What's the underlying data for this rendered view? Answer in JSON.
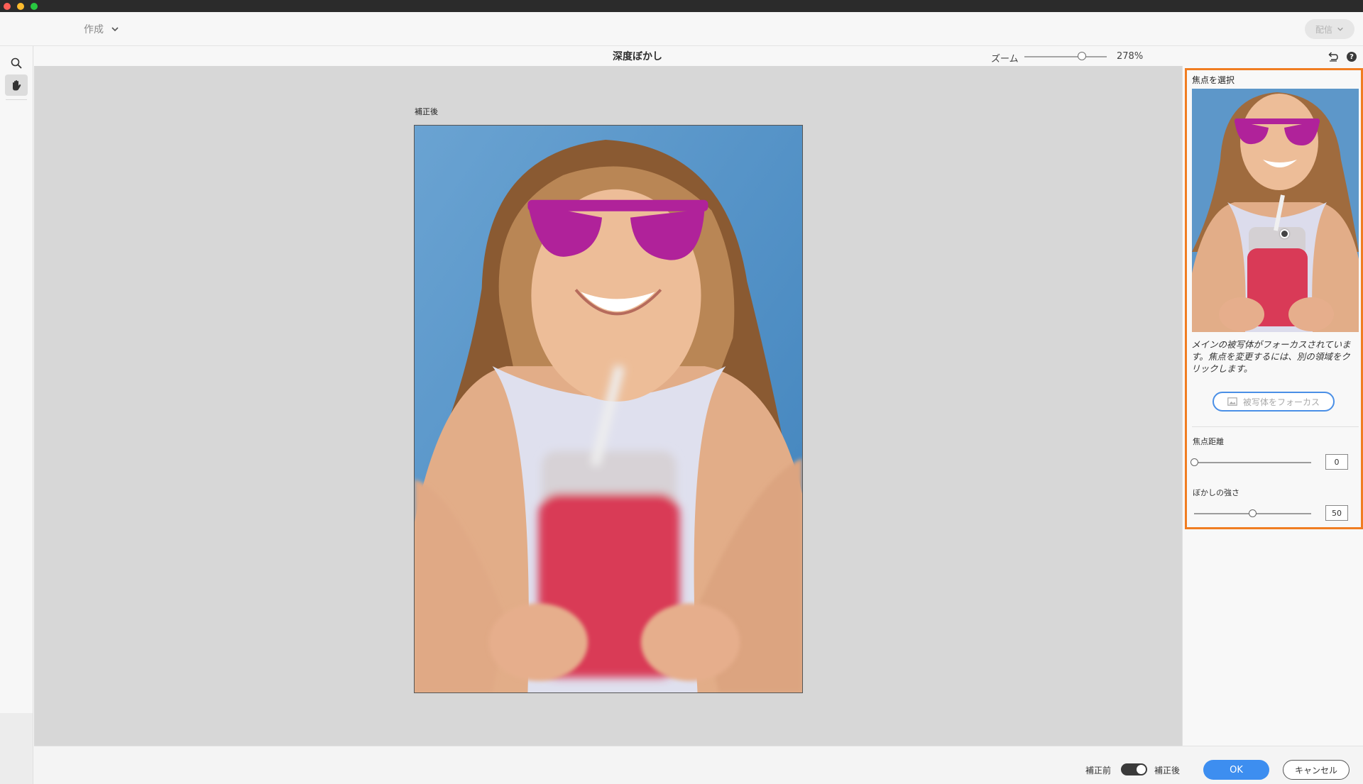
{
  "app": {
    "create_menu_label": "作成",
    "share_label": "配信"
  },
  "header": {
    "title": "深度ぼかし",
    "zoom_label": "ズーム",
    "zoom_value": "278%",
    "zoom_level": 0.7
  },
  "canvas": {
    "view_label": "補正後"
  },
  "panel": {
    "section_title": "焦点を選択",
    "description": "メインの被写体がフォーカスされています。焦点を変更するには、別の領域をクリックします。",
    "focus_subject_button": "被写体をフォーカス",
    "focal_distance": {
      "label": "焦点距離",
      "value": "0",
      "level": 0
    },
    "blur_strength": {
      "label": "ぼかしの強さ",
      "value": "50",
      "level": 0.5
    }
  },
  "footer": {
    "before_label": "補正前",
    "after_label": "補正後",
    "toggle_on": true,
    "ok_label": "OK",
    "cancel_label": "キャンセル"
  },
  "colors": {
    "highlight": "#f07d22",
    "primary": "#3d8ef0",
    "photo_background": "#4d8ec4",
    "sunglasses": "#b0229a",
    "drink": "#d93a57"
  }
}
